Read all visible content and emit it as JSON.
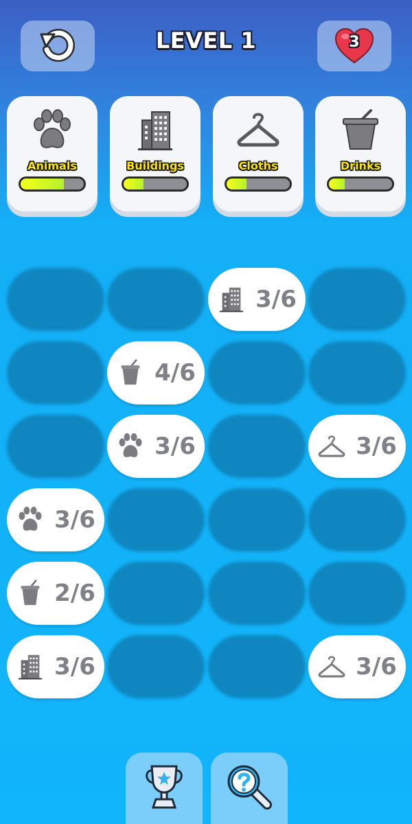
{
  "header": {
    "level_title": "LEVEL 1",
    "lives": "3",
    "restart_icon": "restart-arrow-icon",
    "lives_icon": "heart-icon"
  },
  "categories": [
    {
      "label": "Animals",
      "icon": "paw-icon",
      "progress": 0.68
    },
    {
      "label": "Buildings",
      "icon": "building-icon",
      "progress": 0.32
    },
    {
      "label": "Cloths",
      "icon": "hanger-icon",
      "progress": 0.32
    },
    {
      "label": "Drinks",
      "icon": "cup-icon",
      "progress": 0.25
    }
  ],
  "board": {
    "rows": [
      [
        null,
        null,
        {
          "icon": "building",
          "count": "3/6"
        },
        null
      ],
      [
        null,
        {
          "icon": "cup",
          "count": "4/6"
        },
        null,
        null
      ],
      [
        null,
        {
          "icon": "paw",
          "count": "3/6"
        },
        null,
        {
          "icon": "hanger",
          "count": "3/6"
        }
      ],
      [
        {
          "icon": "paw",
          "count": "3/6"
        },
        null,
        null,
        null
      ],
      [
        {
          "icon": "cup",
          "count": "2/6"
        },
        null,
        null,
        null
      ],
      [
        {
          "icon": "building",
          "count": "3/6"
        },
        null,
        null,
        {
          "icon": "hanger",
          "count": "3/6"
        }
      ]
    ]
  },
  "bottom_bar": {
    "trophy_icon": "trophy-icon",
    "hint_icon": "magnifier-question-icon"
  },
  "colors": {
    "background_top": "#3d5fc4",
    "background_main": "#11b5fb",
    "empty_slot": "#0f86bf",
    "label_yellow": "#ffe600",
    "progress_fill": "#c8f52a",
    "heart": "#e8374a"
  }
}
